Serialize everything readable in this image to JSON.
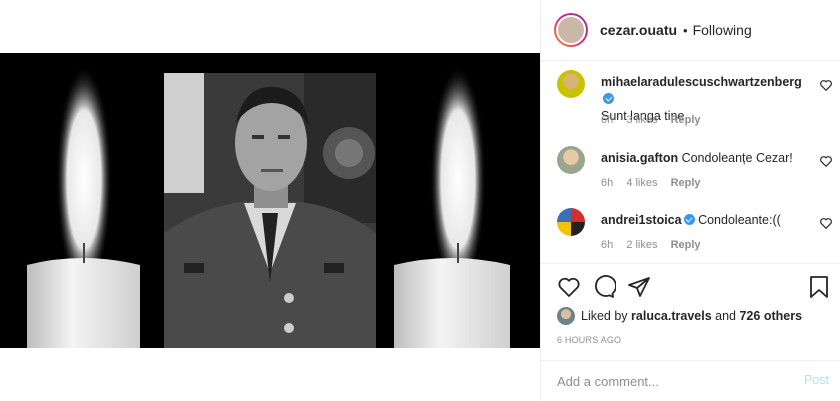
{
  "header": {
    "username": "cezar.ouatu",
    "separator": "•",
    "follow_status": "Following"
  },
  "comments": [
    {
      "username": "mihaelaradulescuschwartzenberg",
      "verified": true,
      "text": "Sunt langa tine.",
      "time": "6h",
      "likes": "3 likes",
      "reply": "Reply"
    },
    {
      "username": "anisia.gafton",
      "verified": false,
      "text": "Condoleanțe Cezar!",
      "time": "6h",
      "likes": "4 likes",
      "reply": "Reply"
    },
    {
      "username": "andrei1stoica",
      "verified": true,
      "text": "Condoleante:((",
      "time": "6h",
      "likes": "2 likes",
      "reply": "Reply"
    }
  ],
  "likes": {
    "prefix": "Liked by",
    "user": "raluca.travels",
    "and": "and",
    "others": "726 others"
  },
  "timestamp": "6 HOURS AGO",
  "add_comment": {
    "placeholder": "Add a comment...",
    "post_label": "Post"
  },
  "colors": {
    "verified": "#3897f0",
    "post_disabled": "#b2dffc",
    "meta_gray": "#8e8e8e"
  }
}
